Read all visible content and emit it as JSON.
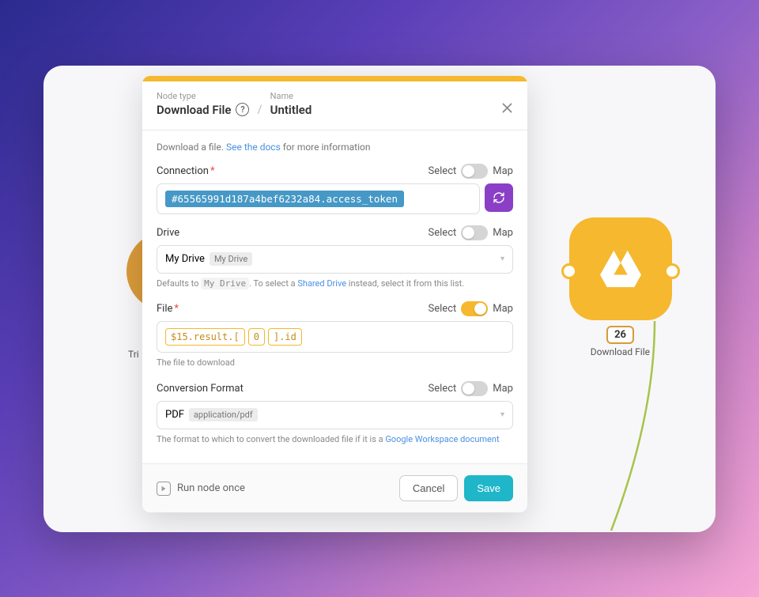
{
  "header": {
    "nodeTypeLabel": "Node type",
    "nodeType": "Download File",
    "nameLabel": "Name",
    "name": "Untitled"
  },
  "docLine": {
    "prefix": "Download a file. ",
    "link": "See the docs",
    "suffix": " for more information"
  },
  "fields": {
    "connection": {
      "label": "Connection",
      "required": true,
      "selectLabel": "Select",
      "mapLabel": "Map",
      "toggleOn": false,
      "value": "#65565991d187a4bef6232a84.access_token"
    },
    "drive": {
      "label": "Drive",
      "required": false,
      "selectLabel": "Select",
      "mapLabel": "Map",
      "toggleOn": false,
      "value": "My Drive",
      "badge": "My Drive",
      "helpPrefix": "Defaults to ",
      "helpCode": "My Drive",
      "helpMid": ". To select a ",
      "helpLink": "Shared Drive",
      "helpSuffix": " instead, select it from this list."
    },
    "file": {
      "label": "File",
      "required": true,
      "selectLabel": "Select",
      "mapLabel": "Map",
      "toggleOn": true,
      "tokens": [
        "$15.result.[",
        "0",
        "].id"
      ],
      "help": "The file to download"
    },
    "format": {
      "label": "Conversion Format",
      "required": false,
      "selectLabel": "Select",
      "mapLabel": "Map",
      "toggleOn": false,
      "value": "PDF",
      "badge": "application/pdf",
      "helpPrefix": "The format to which to convert the downloaded file if it is a ",
      "helpLink": "Google Workspace document"
    }
  },
  "footer": {
    "runOnce": "Run node once",
    "cancel": "Cancel",
    "save": "Save"
  },
  "bgNodes": {
    "leftLabel": "Tri",
    "rightBadge": "26",
    "rightLabel": "Download File"
  }
}
